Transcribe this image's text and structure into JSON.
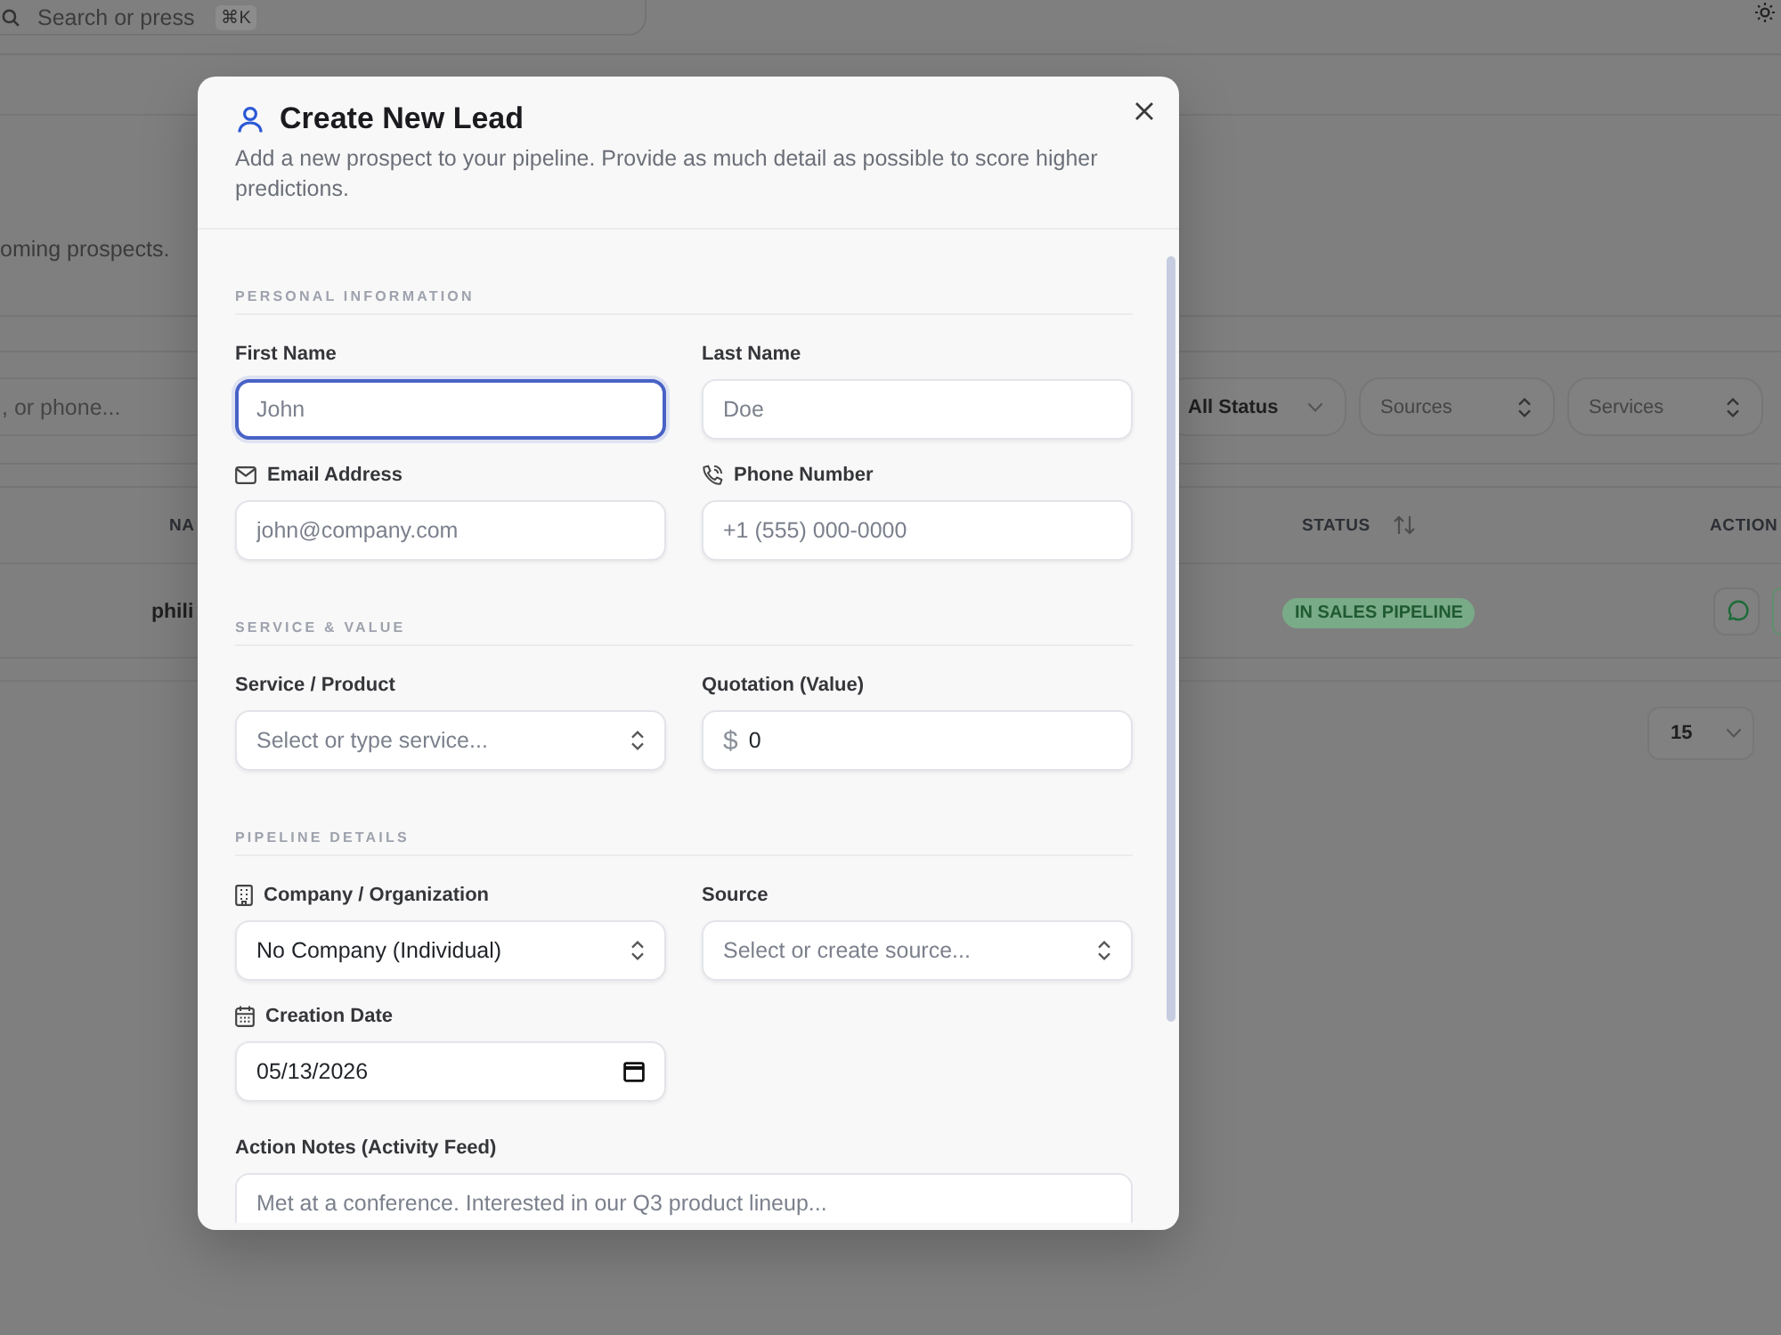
{
  "page": {
    "search": {
      "placeholder": "Search or press",
      "shortcut": "⌘K"
    },
    "subtitle": "oming prospects.",
    "list_search": {
      "placeholder": ", or phone..."
    },
    "filters": [
      {
        "label": "All Status",
        "kind": "dropdown"
      },
      {
        "label": "Sources",
        "kind": "combobox"
      },
      {
        "label": "Services",
        "kind": "combobox"
      }
    ],
    "table": {
      "columns": [
        {
          "label": "NA",
          "sortable": false
        },
        {
          "label": "STATUS",
          "sortable": true
        },
        {
          "label": "ACTION",
          "sortable": false
        }
      ],
      "rows": [
        {
          "name": "phili",
          "status": "IN SALES PIPELINE"
        }
      ]
    },
    "page_size": "15"
  },
  "dialog": {
    "title": "Create New Lead",
    "description": "Add a new prospect to your pipeline. Provide as much detail as possible to score higher predictions.",
    "sections": [
      {
        "title": "PERSONAL INFORMATION",
        "fields": [
          {
            "kind": "text",
            "label": "First Name",
            "placeholder": "John",
            "focused": true
          },
          {
            "kind": "text",
            "label": "Last Name",
            "placeholder": "Doe",
            "focused": false
          },
          {
            "kind": "email",
            "label": "Email Address",
            "placeholder": "john@company.com",
            "focused": false
          },
          {
            "kind": "phone",
            "label": "Phone Number",
            "placeholder": "+1 (555) 000-0000",
            "focused": false
          }
        ]
      },
      {
        "title": "SERVICE & VALUE",
        "fields": [
          {
            "kind": "select",
            "label": "Service / Product",
            "placeholder": "Select or type service...",
            "focused": false
          },
          {
            "kind": "currency",
            "label": "Quotation (Value)",
            "prefix": "$",
            "value": "0",
            "focused": false
          }
        ]
      },
      {
        "title": "PIPELINE DETAILS",
        "fields": [
          {
            "kind": "company",
            "label": "Company / Organization",
            "value": "No Company (Individual)",
            "focused": false
          },
          {
            "kind": "select",
            "label": "Source",
            "placeholder": "Select or create source...",
            "focused": false
          },
          {
            "kind": "date",
            "label": "Creation Date",
            "value": "05/13/2026",
            "focused": false
          },
          {
            "kind": "notes",
            "label": "Action Notes (Activity Feed)",
            "placeholder": "Met at a conference. Interested in our Q3 product lineup...",
            "focused": false
          }
        ]
      }
    ]
  }
}
